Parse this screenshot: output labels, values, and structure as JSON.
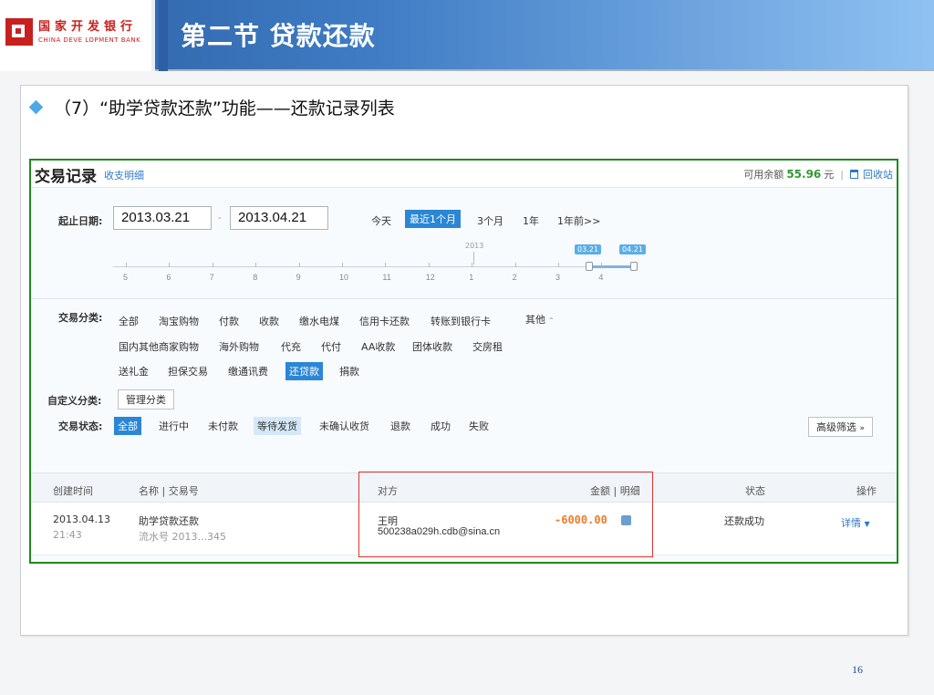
{
  "logo": {
    "cn": "国家开发银行",
    "en": "CHINA DEVE LOPMENT BANK"
  },
  "title": "第二节  贷款还款",
  "bullet": "（7）“助学贷款还款”功能——还款记录列表",
  "page_number": "16",
  "record": {
    "title": "交易记录",
    "sub_link": "收支明细",
    "balance_label": "可用余额",
    "balance_amount": "55.96",
    "balance_unit": "元",
    "recycle_label": "回收站",
    "date_label": "起止日期:",
    "start_date": "2013.03.21",
    "dash": "-",
    "end_date": "2013.04.21",
    "ranges": [
      "今天",
      "最近1个月",
      "3个月",
      "1年",
      "1年前>>"
    ],
    "timeline_year": "2013",
    "timeline_ticks": [
      "5",
      "6",
      "7",
      "8",
      "9",
      "10",
      "11",
      "12",
      "1",
      "2",
      "3",
      "4"
    ],
    "handle_start": "03.21",
    "handle_end": "04.21",
    "category_label": "交易分类:",
    "categories_row1": [
      "全部",
      "淘宝购物",
      "付款",
      "收款",
      "缴水电煤",
      "信用卡还款",
      "转账到银行卡"
    ],
    "other_label": "其他",
    "categories_row2": [
      "国内其他商家购物",
      "海外购物",
      "代充",
      "代付",
      "AA收款",
      "团体收款",
      "交房租"
    ],
    "categories_row3": [
      "送礼金",
      "担保交易",
      "缴通讯费",
      "还贷款",
      "捐款"
    ],
    "custom_label": "自定义分类:",
    "manage_label": "管理分类",
    "status_label": "交易状态:",
    "statuses": [
      "全部",
      "进行中",
      "未付款",
      "等待发货",
      "未确认收货",
      "退款",
      "成功",
      "失败"
    ],
    "advanced_filter": "高级筛选",
    "columns": {
      "created": "创建时间",
      "name": "名称 | 交易号",
      "party": "对方",
      "amount": "金额 | 明细",
      "state": "状态",
      "action": "操作"
    },
    "rows": [
      {
        "date": "2013.04.13",
        "time": "21:43",
        "name": "助学贷款还款",
        "serial": "流水号 2013...345",
        "party_name": "王明",
        "party_email": "500238a029h.cdb@sina.cn",
        "amount": "-6000.00",
        "state": "还款成功",
        "action": "详情"
      }
    ]
  },
  "colors": {
    "accent": "#2b86d6",
    "frame_green": "#1f8a1f",
    "highlight_red": "#e2332f",
    "amount_orange": "#f07b2a",
    "balance_green": "#2f9a2f"
  }
}
